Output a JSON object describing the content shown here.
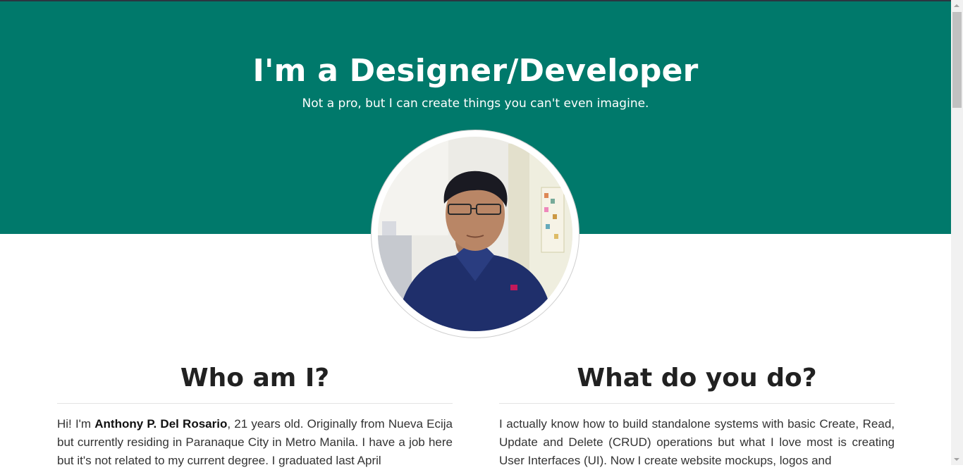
{
  "hero": {
    "title": "I'm a Designer/Developer",
    "subtitle": "Not a pro, but I can create things you can't even imagine.",
    "background_color": "#00796b"
  },
  "profile_photo": {
    "icon": "profile-photo"
  },
  "about": {
    "heading": "Who am I?",
    "intro": "Hi! I'm ",
    "name": "Anthony P. Del Rosario",
    "text": ", 21 years old. Originally from Nueva Ecija but currently residing in Paranaque City in Metro Manila. I have a job here but it's not related to my current degree. I graduated last April"
  },
  "work": {
    "heading": "What do you do?",
    "text": "I actually know how to build standalone systems with basic Create, Read, Update and Delete (CRUD) operations but what I love most is creating User Interfaces (UI). Now I create website mockups, logos and"
  }
}
